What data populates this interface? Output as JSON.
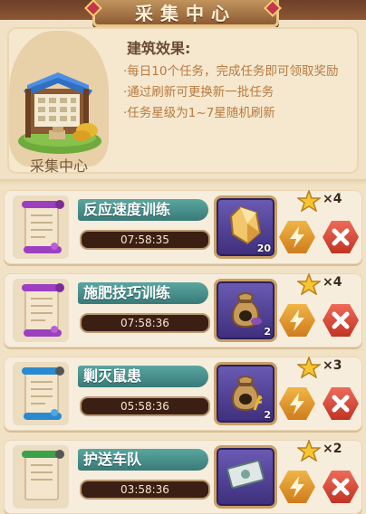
{
  "header": {
    "title": "采集中心"
  },
  "building": {
    "name": "采集中心"
  },
  "effects": {
    "title": "建筑效果:",
    "lines": [
      "·每日10个任务，完成任务即可领取奖励",
      "·通过刷新可更换新一批任务",
      "·任务星级为1~7星随机刷新"
    ]
  },
  "tasks": [
    {
      "name": "反应速度训练",
      "timer": "07:58:35",
      "reward_icon": "crystal-icon",
      "reward_count": "20",
      "stars": "×4",
      "scroll_color": "#9d3fc1"
    },
    {
      "name": "施肥技巧训练",
      "timer": "07:58:36",
      "reward_icon": "seed-bag-icon",
      "reward_count": "2",
      "stars": "×4",
      "scroll_color": "#9d3fc1"
    },
    {
      "name": "剿灭鼠患",
      "timer": "05:58:36",
      "reward_icon": "grain-bag-icon",
      "reward_count": "2",
      "stars": "×3",
      "scroll_color": "#2a8ad0"
    },
    {
      "name": "护送车队",
      "timer": "03:58:36",
      "reward_icon": "banknote-icon",
      "reward_count": "",
      "stars": "×2",
      "scroll_color": "#3aa24a"
    }
  ],
  "colors": {
    "gold": "#f6c531",
    "refresh": "#e79c2e",
    "cancel": "#dc4b3b",
    "name_plate": "#4b908c"
  }
}
